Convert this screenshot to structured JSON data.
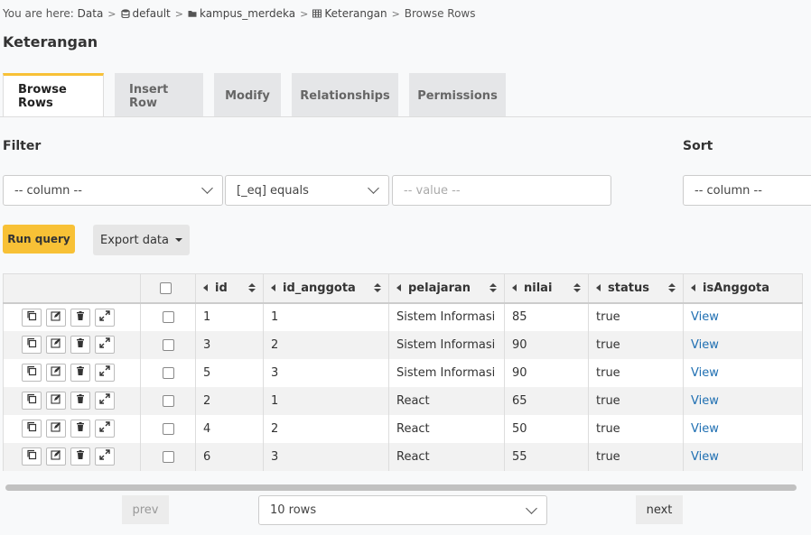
{
  "breadcrumb": {
    "prefix": "You are here:",
    "items": [
      "Data",
      "default",
      "kampus_merdeka",
      "Keterangan",
      "Browse Rows"
    ]
  },
  "page": {
    "title": "Keterangan"
  },
  "tabs": [
    {
      "label": "Browse Rows",
      "active": true
    },
    {
      "label": "Insert Row",
      "active": false
    },
    {
      "label": "Modify",
      "active": false
    },
    {
      "label": "Relationships",
      "active": false
    },
    {
      "label": "Permissions",
      "active": false
    }
  ],
  "filter": {
    "label": "Filter",
    "column_value": "-- column --",
    "operator_value": "[_eq] equals",
    "value_placeholder": "-- value --"
  },
  "sort": {
    "label": "Sort",
    "column_value": "-- column --"
  },
  "actions": {
    "run_query": "Run query",
    "export": "Export data"
  },
  "table": {
    "columns": [
      "id",
      "id_anggota",
      "pelajaran",
      "nilai",
      "status",
      "isAnggota"
    ],
    "rows": [
      [
        "1",
        "1",
        "Sistem Informasi",
        "85",
        "true",
        "View"
      ],
      [
        "3",
        "2",
        "Sistem Informasi",
        "90",
        "true",
        "View"
      ],
      [
        "5",
        "3",
        "Sistem Informasi",
        "90",
        "true",
        "View"
      ],
      [
        "2",
        "1",
        "React",
        "65",
        "true",
        "View"
      ],
      [
        "4",
        "2",
        "React",
        "50",
        "true",
        "View"
      ],
      [
        "6",
        "3",
        "React",
        "55",
        "true",
        "View"
      ]
    ]
  },
  "pagination": {
    "prev": "prev",
    "rows": "10 rows",
    "next": "next"
  },
  "colors": {
    "accent": "#f8c136",
    "link": "#1f6fb2"
  }
}
